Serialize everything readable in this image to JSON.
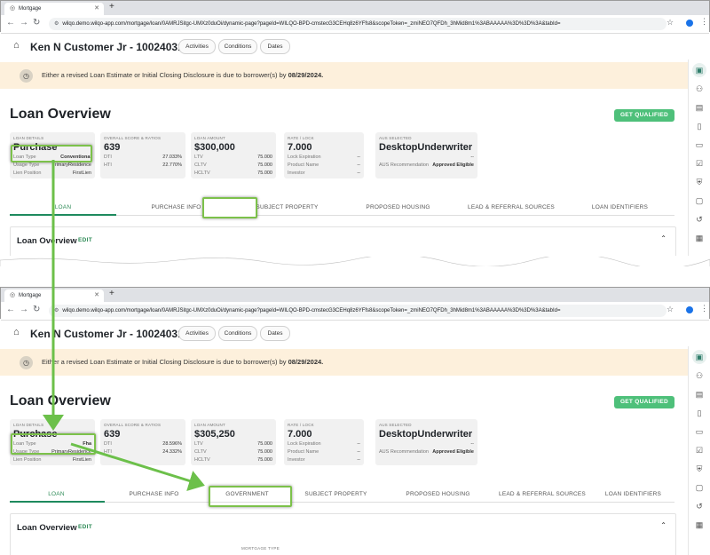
{
  "browser": {
    "tab_title": "Mortgage",
    "url": "wilqo.demo.wilqo-app.com/mortgage/loan/0AMRJSitgc-UMXz0duOi/dynamic-page?pageId=WILQO-BPD-cmstecG3CEHq8z6YFfs8&scopeToken=_zmiNEO7QFDh_3hMid8m1%3ABAAAAA%3D%3D%3A&tabId=",
    "icons": [
      "globe-icon",
      "close-icon",
      "plus-icon",
      "back-arrow-icon",
      "forward-arrow-icon",
      "reload-icon",
      "lock-icon",
      "star-icon",
      "profile-icon",
      "kebab-icon"
    ]
  },
  "header": {
    "customer": "Ken N Customer Jr - 100240310061",
    "chips": [
      "Activities",
      "Conditions",
      "Dates"
    ],
    "home_icon": "home-icon"
  },
  "banner": {
    "text_prefix": "Either a revised Loan Estimate or Initial Closing Disclosure is due to borrower(s) by ",
    "date": "08/29/2024."
  },
  "page": {
    "title": "Loan Overview",
    "cta": "GET QUALIFIED"
  },
  "screens": [
    {
      "cards": {
        "details": {
          "caption": "LOAN DETAILS",
          "big": "Purchase",
          "rows": [
            {
              "label": "Loan Type",
              "value": "Conventional"
            },
            {
              "label": "Usage Type",
              "value": "PrimaryResidence"
            },
            {
              "label": "Lien Position",
              "value": "FirstLien"
            }
          ]
        },
        "score": {
          "caption": "OVERALL SCORE & RATIOS",
          "big": "639",
          "rows": [
            {
              "label": "DTI",
              "value": "27.033%"
            },
            {
              "label": "HTI",
              "value": "22.770%"
            }
          ]
        },
        "amount": {
          "caption": "LOAN AMOUNT",
          "big": "$300,000",
          "rows": [
            {
              "label": "LTV",
              "value": "75.000"
            },
            {
              "label": "CLTV",
              "value": "75.000"
            },
            {
              "label": "HCLTV",
              "value": "75.000"
            }
          ]
        },
        "rate": {
          "caption": "RATE / LOCK",
          "big": "7.000",
          "rows": [
            {
              "label": "Lock Expiration",
              "value": "--"
            },
            {
              "label": "Product Name",
              "value": "--"
            },
            {
              "label": "Investor",
              "value": "--"
            }
          ]
        },
        "aus": {
          "caption": "AUS SELECTED",
          "big": "DesktopUnderwriter",
          "rows": [
            {
              "label": "",
              "value": "--"
            },
            {
              "label": "AUS Recommendation",
              "value": "Approved Eligible"
            }
          ]
        }
      },
      "tabs": [
        "LOAN",
        "PURCHASE INFO",
        "",
        "SUBJECT PROPERTY",
        "PROPOSED HOUSING",
        "LEAD & REFERRAL SOURCES",
        "LOAN IDENTIFIERS"
      ]
    },
    {
      "cards": {
        "details": {
          "caption": "LOAN DETAILS",
          "big": "Purchase",
          "rows": [
            {
              "label": "Loan Type",
              "value": "Fha"
            },
            {
              "label": "Usage Type",
              "value": "PrimaryResidence"
            },
            {
              "label": "Lien Position",
              "value": "FirstLien"
            }
          ]
        },
        "score": {
          "caption": "OVERALL SCORE & RATIOS",
          "big": "639",
          "rows": [
            {
              "label": "DTI",
              "value": "28.596%"
            },
            {
              "label": "HTI",
              "value": "24.332%"
            }
          ]
        },
        "amount": {
          "caption": "LOAN AMOUNT",
          "big": "$305,250",
          "rows": [
            {
              "label": "LTV",
              "value": "75.000"
            },
            {
              "label": "CLTV",
              "value": "75.000"
            },
            {
              "label": "HCLTV",
              "value": "75.000"
            }
          ]
        },
        "rate": {
          "caption": "RATE / LOCK",
          "big": "7.000",
          "rows": [
            {
              "label": "Lock Expiration",
              "value": "--"
            },
            {
              "label": "Product Name",
              "value": "--"
            },
            {
              "label": "Investor",
              "value": "--"
            }
          ]
        },
        "aus": {
          "caption": "AUS SELECTED",
          "big": "DesktopUnderwriter",
          "rows": [
            {
              "label": "",
              "value": "--"
            },
            {
              "label": "AUS Recommendation",
              "value": "Approved Eligible"
            }
          ]
        }
      },
      "tabs": [
        "LOAN",
        "PURCHASE INFO",
        "GOVERNMENT",
        "SUBJECT PROPERTY",
        "PROPOSED HOUSING",
        "LEAD & REFERRAL SOURCES",
        "LOAN IDENTIFIERS"
      ]
    }
  ],
  "section": {
    "title": "Loan Overview",
    "edit": "EDIT",
    "field_label": "MORTGAGE TYPE"
  },
  "sidebar_icons": [
    "dashboard-icon",
    "people-icon",
    "building-icon",
    "document-icon",
    "file-icon",
    "checklist-icon",
    "shield-icon",
    "chat-icon",
    "history-icon",
    "calendar-icon"
  ],
  "colors": {
    "accent": "#4ec07a",
    "tab_active": "#2e8b57",
    "banner_bg": "#fdf0dc",
    "highlight": "#7cc14a"
  }
}
